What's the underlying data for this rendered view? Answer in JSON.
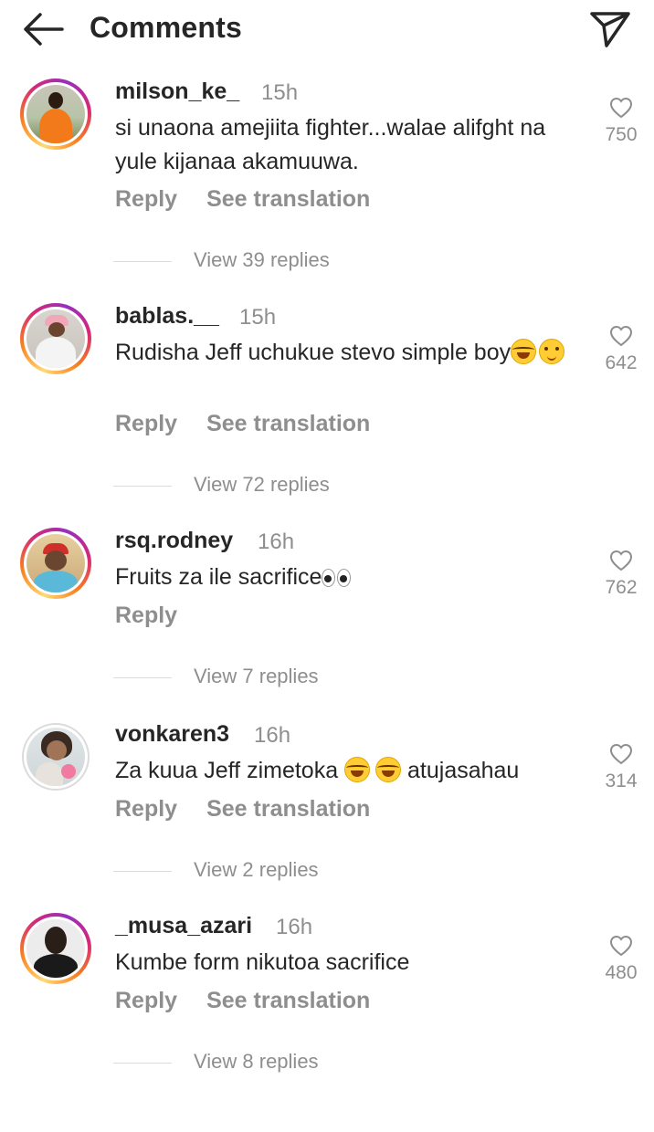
{
  "header": {
    "title": "Comments",
    "back_icon": "arrow-left-icon",
    "share_icon": "paper-plane-icon"
  },
  "comments": [
    {
      "username": "milson_ke_",
      "time": "15h",
      "text": "si unaona amejiita fighter...walae alifght na yule  kijanaa akamuuwa.",
      "likes": "750",
      "reply": "Reply",
      "see_translation": "See translation",
      "view_replies": "View 39 replies",
      "story_ring": true
    },
    {
      "username": "bablas.__",
      "time": "15h",
      "text": "Rudisha Jeff uchukue stevo simple boy",
      "emojis": [
        "face-with-tears-of-joy",
        "woozy-face"
      ],
      "likes": "642",
      "reply": "Reply",
      "see_translation": "See translation",
      "view_replies": "View 72 replies",
      "story_ring": true
    },
    {
      "username": "rsq.rodney",
      "time": "16h",
      "text": "Fruits za ile sacrifice",
      "emojis": [
        "eyes"
      ],
      "likes": "762",
      "reply": "Reply",
      "view_replies": "View 7 replies",
      "story_ring": true
    },
    {
      "username": "vonkaren3",
      "time": "16h",
      "text_before": "Za kuua Jeff zimetoka ",
      "emojis": [
        "face-with-tears-of-joy",
        "face-with-tears-of-joy"
      ],
      "text_after": " atujasahau",
      "likes": "314",
      "reply": "Reply",
      "see_translation": "See translation",
      "view_replies": "View 2 replies",
      "story_ring": false
    },
    {
      "username": "_musa_azari",
      "time": "16h",
      "text": "Kumbe form nikutoa sacrifice",
      "likes": "480",
      "reply": "Reply",
      "see_translation": "See translation",
      "view_replies": "View 8 replies",
      "story_ring": true
    }
  ],
  "colors": {
    "text": "#262626",
    "secondary": "#8e8e8e",
    "divider": "#dbdbdb"
  }
}
